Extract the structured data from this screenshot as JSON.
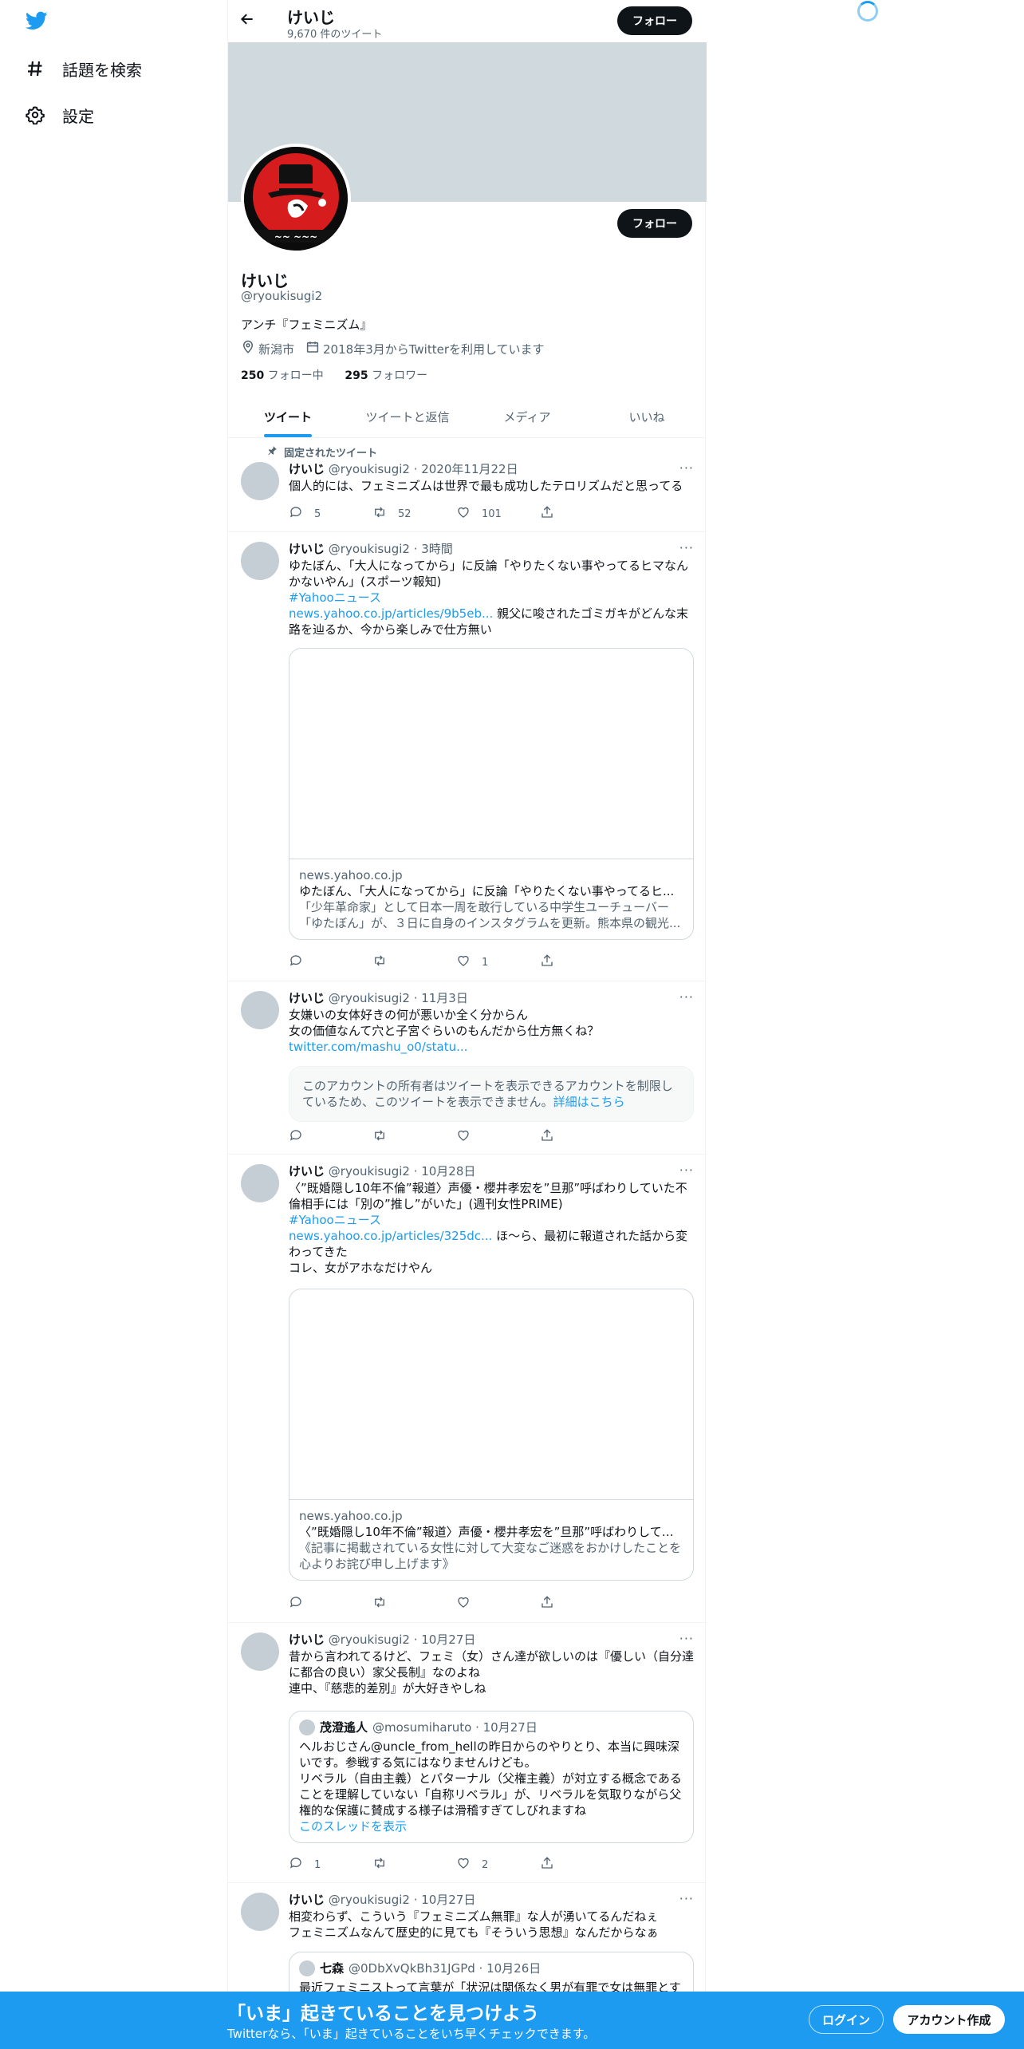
{
  "nav": {
    "items": [
      {
        "label": "話題を検索",
        "icon": "hashtag-icon"
      },
      {
        "label": "設定",
        "icon": "gear-icon"
      }
    ]
  },
  "header": {
    "name": "けいじ",
    "tweet_count": "9,670 件のツイート",
    "follow_label": "フォロー"
  },
  "profile": {
    "name": "けいじ",
    "handle": "@ryoukisugi2",
    "bio": "アンチ『フェミニズム』",
    "location": "新潟市",
    "joined": "2018年3月からTwitterを利用しています",
    "following_count": "250",
    "following_label": " フォロー中",
    "followers_count": "295",
    "followers_label": " フォロワー",
    "follow_label": "フォロー"
  },
  "tabs": [
    "ツイート",
    "ツイートと返信",
    "メディア",
    "いいね"
  ],
  "tweets": [
    {
      "pinned_label": "固定されたツイート",
      "name": "けいじ",
      "meta": " @ryoukisugi2 · 2020年11月22日",
      "text": "個人的には、フェミニズムは世界で最も成功したテロリズムだと思ってる",
      "replies": "5",
      "retweets": "52",
      "likes": "101"
    },
    {
      "name": "けいじ",
      "meta": " @ryoukisugi2 · 3時間",
      "text1": "ゆたぼん、「大人になってから」に反論「やりたくない事やってるヒマなんかないやん」(スポーツ報知)",
      "hashtag": "#Yahooニュース",
      "link": "news.yahoo.co.jp/articles/9b5eb...",
      "text2": " 親父に唆されたゴミガキがどんな末路を辿るか、今から楽しみで仕方無い",
      "card_domain": "news.yahoo.co.jp",
      "card_title": "ゆたぼん、「大人になってから」に反論「やりたくない事やってるヒ...",
      "card_desc": "「少年革命家」として日本一周を敢行している中学生ユーチューバー「ゆたぼん」が、３日に自身のインスタグラムを更新。熊本県の観光...",
      "replies": "",
      "retweets": "",
      "likes": "1"
    },
    {
      "name": "けいじ",
      "meta": " @ryoukisugi2 · 11月3日",
      "text1": "女嫌いの女体好きの何が悪いか全く分からん",
      "text2": "女の価値なんて穴と子宮ぐらいのもんだから仕方無くね？",
      "link": "twitter.com/mashu_o0/statu...",
      "notice": "このアカウントの所有者はツイートを表示できるアカウントを制限しているため、このツイートを表示できません。",
      "notice_link": "詳細はこちら",
      "replies": "",
      "retweets": "",
      "likes": ""
    },
    {
      "name": "けいじ",
      "meta": " @ryoukisugi2 · 10月28日",
      "text1": "〈”既婚隠し10年不倫”報道〉声優・櫻井孝宏を”旦那”呼ばわりしていた不倫相手には「別の”推し”がいた」(週刊女性PRIME)",
      "hashtag": "#Yahooニュース",
      "link": "news.yahoo.co.jp/articles/325dc...",
      "text2": " ほ〜ら、最初に報道された話から変わってきた",
      "text3": "コレ、女がアホなだけやん",
      "card_domain": "news.yahoo.co.jp",
      "card_title": "〈”既婚隠し10年不倫”報道〉声優・櫻井孝宏を”旦那”呼ばわりしてい...",
      "card_desc": "《記事に掲載されている女性に対して大変なご迷惑をおかけしたことを心よりお詫び申し上げます》",
      "replies": "",
      "retweets": "",
      "likes": ""
    },
    {
      "name": "けいじ",
      "meta": " @ryoukisugi2 · 10月27日",
      "text1": "昔から言われてるけど、フェミ（女）さん達が欲しいのは『優しい（自分達に都合の良い）家父長制』なのよね",
      "text2": "連中、『慈悲的差別』が大好きやしね",
      "quote_name": "茂澄遙人",
      "quote_meta": "@mosumiharuto · 10月27日",
      "quote_text1": "ヘルおじさん@uncle_from_hellの昨日からのやりとり、本当に興味深いです。参戦する気にはなりませんけども。",
      "quote_text2": "リベラル（自由主義）とパターナル（父権主義）が対立する概念であることを理解していない「自称リベラル」が、リベラルを気取りながら父権的な保護に賛成する様子は滑稽すぎてしびれますね",
      "quote_thread": "このスレッドを表示",
      "replies": "1",
      "retweets": "",
      "likes": "2"
    },
    {
      "name": "けいじ",
      "meta": " @ryoukisugi2 · 10月27日",
      "text1": "相変わらず、こういう『フェミニズム無罪』な人が湧いてるんだねぇ",
      "text2": "フェミニズムなんて歴史的に見ても『そういう思想』なんだからなぁ",
      "quote_name": "七森",
      "quote_meta": "@0DbXvQkBh31JGPd · 10月26日",
      "quote_text1": "最近フェミニストって言葉が「状況は関係なく男が有罪で女は無罪とす"
    }
  ],
  "bottom": {
    "title": "「いま」起きていることを見つけよう",
    "subtitle": "Twitterなら、「いま」起きていることをいち早くチェックできます。",
    "login": "ログイン",
    "signup": "アカウント作成"
  },
  "colors": {
    "accent": "#1d9bf0",
    "text": "#0f1419",
    "muted": "#536471",
    "banner": "#cfd9de"
  }
}
